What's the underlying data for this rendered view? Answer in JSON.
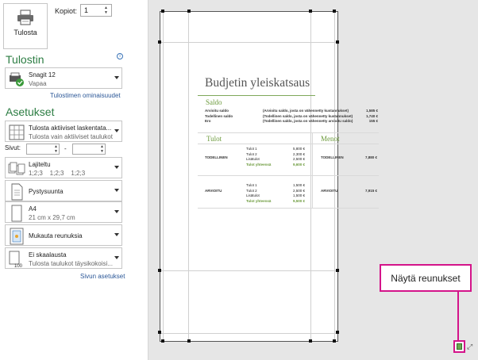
{
  "print": {
    "button_label": "Tulosta",
    "copies_label": "Kopiot:",
    "copies_value": "1"
  },
  "printer": {
    "section_title": "Tulostin",
    "info_icon": "i",
    "name": "Snagit 12",
    "status": "Vapaa",
    "properties_link": "Tulostimen ominaisuudet"
  },
  "settings": {
    "section_title": "Asetukset",
    "scope_main": "Tulosta aktiiviset laskentata...",
    "scope_sub": "Tulosta vain aktiiviset taulukot",
    "pages_label": "Sivut:",
    "pages_to": "-",
    "collate_main": "Lajiteltu",
    "collate_sub": "1;2;3    1;2;3    1;2;3",
    "orientation": "Pystysuunta",
    "paper_main": "A4",
    "paper_sub": "21 cm x 29,7 cm",
    "margins": "Mukauta reunuksia",
    "scaling_main": "Ei skaalausta",
    "scaling_sub": "Tulosta taulukot täysikokoisi...",
    "page_setup_link": "Sivun asetukset"
  },
  "document": {
    "title": "Budjetin yleiskatsaus",
    "saldo_heading": "Saldo",
    "saldo_rows": [
      {
        "label": "Arvioitu saldo",
        "note": "(Arvioitu saldo, josta on vähennetty kustannukset)",
        "amount": "1,585 €"
      },
      {
        "label": "Todellinen saldo",
        "note": "(Todellinen saldo, josta on vähennetty kustannukset)",
        "amount": "1,740 €"
      },
      {
        "label": "Ero",
        "note": "(Todellinen saldo, josta on vähennetty arvioitu saldo)",
        "amount": "155 €"
      }
    ],
    "income_heading": "Tulot",
    "expenses_heading": "Menot",
    "income_blocks": [
      {
        "label": "TODELLINEN",
        "rows": [
          {
            "name": "Tulot 1",
            "amount": "5,800 €"
          },
          {
            "name": "Tulot 2",
            "amount": "2,300 €"
          },
          {
            "name": "Lisätulot",
            "amount": "2,500 €"
          }
        ],
        "total_label": "Tulot yhteensä",
        "total": "9,600 €"
      },
      {
        "label": "ARVIOITU",
        "rows": [
          {
            "name": "Tulot 1",
            "amount": "1,500 €"
          },
          {
            "name": "Tulot 2",
            "amount": "2,500 €"
          },
          {
            "name": "Lisätulot",
            "amount": "1,500 €"
          }
        ],
        "total_label": "Tulot yhteensä",
        "total": "9,500 €"
      }
    ],
    "expense_blocks": [
      {
        "label": "TODELLINEN",
        "amount": "7,880 €"
      },
      {
        "label": "ARVIOITU",
        "amount": "7,915 €"
      }
    ]
  },
  "callout": {
    "text": "Näytä reunukset"
  },
  "zoom_icon": "⤢",
  "colors": {
    "accent_green": "#2c7d43",
    "callout_magenta": "#d4148a",
    "link_blue": "#2b5797"
  }
}
